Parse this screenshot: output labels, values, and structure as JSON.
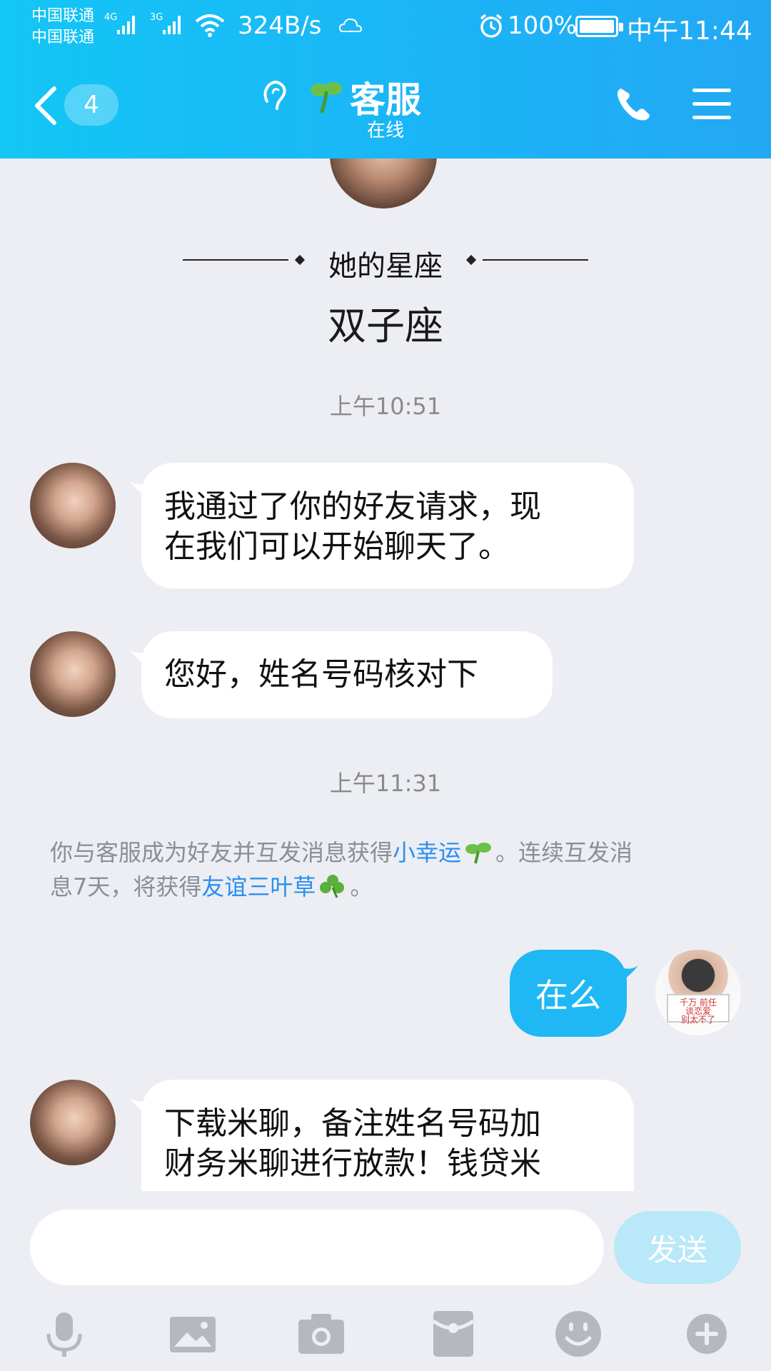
{
  "status_bar": {
    "carrier_1": "中国联通",
    "carrier_2": "中国联通",
    "net_1": "4G",
    "net_2": "3G",
    "net_speed": "324B/s",
    "battery_percent": "100%",
    "time": "中午11:44"
  },
  "header": {
    "unread_count": "4",
    "title": "客服",
    "status": "在线"
  },
  "profile": {
    "zodiac_label": "她的星座",
    "zodiac_value": "双子座"
  },
  "messages": [
    {
      "type": "timestamp",
      "text": "上午10:51"
    },
    {
      "type": "incoming",
      "text_line1": "我通过了你的好友请求，现",
      "text_line2": "在我们可以开始聊天了。"
    },
    {
      "type": "incoming",
      "text": "您好，姓名号码核对下"
    },
    {
      "type": "timestamp",
      "text": "上午11:31"
    },
    {
      "type": "system",
      "part1": "你与客服成为好友并互发消息获得",
      "link1": "小幸运",
      "part2": "。连续互发消",
      "part3": "息7天，将获得",
      "link2": "友谊三叶草",
      "part4": "。"
    },
    {
      "type": "outgoing",
      "text": "在么"
    },
    {
      "type": "incoming",
      "text_line1": "下载米聊，备注姓名号码加",
      "text_line2": "财务米聊进行放款！钱贷米"
    }
  ],
  "self_avatar_sign": {
    "line1": "千万 前任",
    "line2": "谈恋爱",
    "line3": "别太不了"
  },
  "input": {
    "placeholder": "",
    "send_label": "发送"
  },
  "toolbar": [
    "microphone-icon",
    "image-icon",
    "camera-icon",
    "red-packet-icon",
    "emoji-icon",
    "plus-icon"
  ],
  "colors": {
    "header_gradient_start": "#13c6f5",
    "header_gradient_end": "#23a8f4",
    "outgoing_bubble": "#1fb8f4",
    "link": "#2b8ff0",
    "send_button_disabled": "#b9e8f8",
    "background": "#eceef3"
  }
}
